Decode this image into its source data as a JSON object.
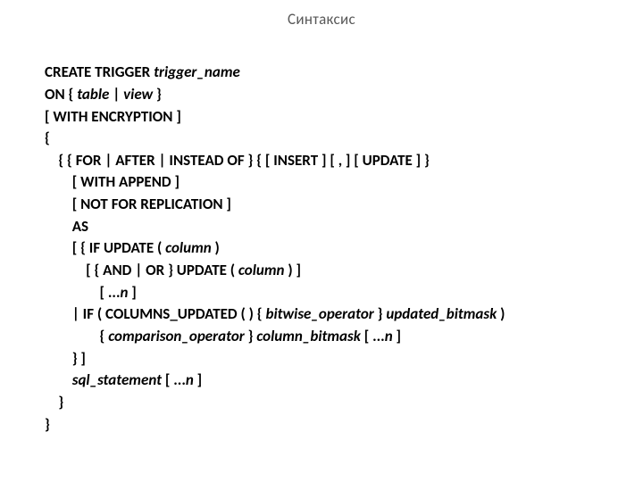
{
  "title": "Синтаксис",
  "syntax": {
    "l1_kw": "CREATE TRIGGER ",
    "l1_it": "trigger_name",
    "l2_kw": "ON { ",
    "l2_it1": "table",
    "l2_sep": " | ",
    "l2_it2": "view",
    "l2_end": " }",
    "l3_kw": "[ WITH ENCRYPTION ]",
    "l4": "{",
    "l5_pad": "    ",
    "l5_kw": "{ { FOR | AFTER | INSTEAD OF } { [ INSERT ] [ , ] [ UPDATE ] }",
    "l6_pad": "        ",
    "l6_kw": "[ WITH APPEND ]",
    "l7_pad": "        ",
    "l7_kw": "[ NOT FOR REPLICATION ]",
    "l8_pad": "        ",
    "l8_kw": "AS",
    "l9_pad": "        ",
    "l9_kw": "[ { IF UPDATE ( ",
    "l9_it": "column",
    "l9_end": " )",
    "l10_pad": "            ",
    "l10_kw": "[ { AND | OR } UPDATE ( ",
    "l10_it": "column",
    "l10_end": " ) ]",
    "l11_pad": "                ",
    "l11_a": "[ ...",
    "l11_it": "n",
    "l11_b": " ]",
    "l12_pad": "        ",
    "l12_a": "| IF ( COLUMNS_UPDATED ( ) { ",
    "l12_it1": "bitwise_operator",
    "l12_b": " } ",
    "l12_it2": "updated_bitmask",
    "l12_c": " )",
    "l13_pad": "                ",
    "l13_a": "{ ",
    "l13_it1": "comparison_operator",
    "l13_b": " } ",
    "l13_it2": "column_bitmask",
    "l13_c": " [ ...",
    "l13_it3": "n",
    "l13_d": " ]",
    "l14_pad": "        ",
    "l14_kw": "} ]",
    "l15_pad": "        ",
    "l15_it": "sql_statement",
    "l15_a": " [ ...",
    "l15_it2": "n",
    "l15_b": " ]",
    "l16_pad": "    ",
    "l16_kw": "}",
    "l17": "}"
  }
}
